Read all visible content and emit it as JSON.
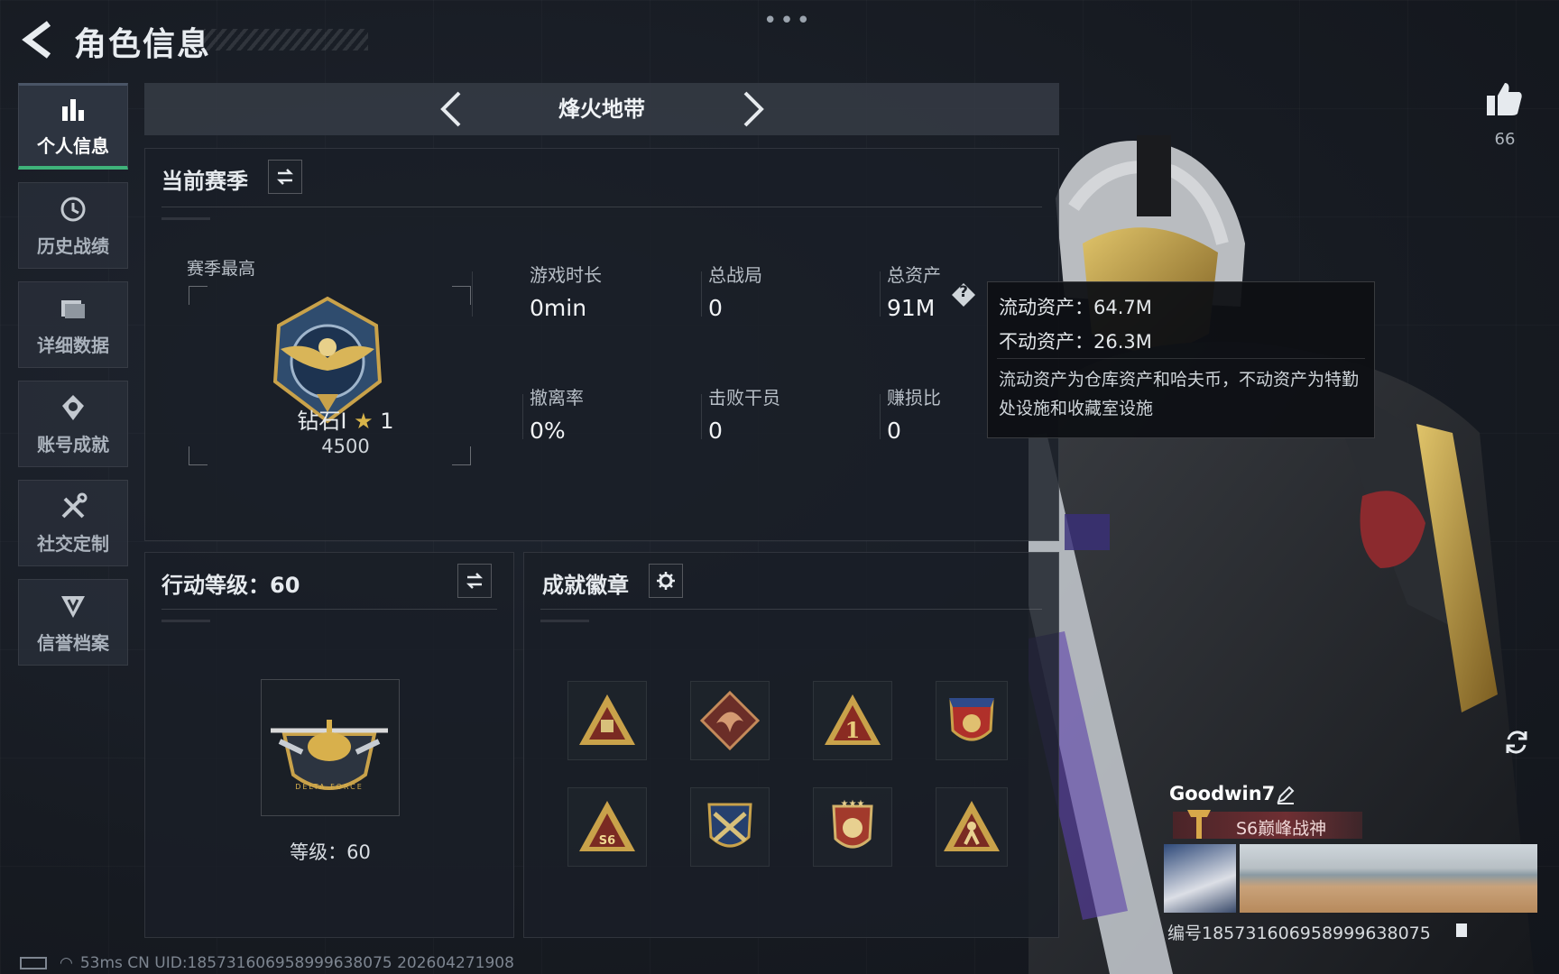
{
  "header": {
    "title": "角色信息",
    "more": "•••"
  },
  "sidebar": {
    "items": [
      {
        "label": "个人信息",
        "icon": "bar-chart-icon",
        "active": true
      },
      {
        "label": "历史战绩",
        "icon": "history-clock-icon"
      },
      {
        "label": "详细数据",
        "icon": "folder-icon"
      },
      {
        "label": "账号成就",
        "icon": "achievement-icon"
      },
      {
        "label": "社交定制",
        "icon": "tools-icon"
      },
      {
        "label": "信誉档案",
        "icon": "credit-icon"
      }
    ]
  },
  "mode": {
    "title": "烽火地带"
  },
  "season": {
    "heading": "当前赛季",
    "best_label": "赛季最高",
    "rank_name": "钻石I",
    "rank_stars": "1",
    "rank_points": "4500",
    "stats": [
      {
        "label": "游戏时长",
        "value": "0min"
      },
      {
        "label": "总战局",
        "value": "0"
      },
      {
        "label": "总资产",
        "value": "91M"
      },
      {
        "label": "撤离率",
        "value": "0%"
      },
      {
        "label": "击败干员",
        "value": "0"
      },
      {
        "label": "赚损比",
        "value": "0"
      }
    ],
    "help_glyph": "?"
  },
  "tooltip": {
    "liquid": "流动资产：64.7M",
    "fixed": "不动资产：26.3M",
    "description": "流动资产为仓库资产和哈夫币，不动资产为特勤处设施和收藏室设施"
  },
  "action_level": {
    "heading": "行动等级：60",
    "level_text": "等级：60",
    "emblem_text": "DELTA FORCE"
  },
  "achievements": {
    "heading": "成就徽章",
    "badges": [
      "triangle-gold-badge",
      "dragon-badge",
      "number-one-badge",
      "shield-star-badge",
      "s6-triangle-badge",
      "crossed-guns-badge",
      "star-shield-badge",
      "climber-badge"
    ],
    "s6_text": "S6",
    "one_text": "1"
  },
  "likes": {
    "count": "66"
  },
  "player": {
    "name": "Goodwin7",
    "title": "S6巅峰战神",
    "uid_line": "编号1857316069589996380​75"
  },
  "footer": {
    "text": "53ms    CN UID:1857316069589996380​75 202604271908"
  },
  "colors": {
    "accent_green": "#3fb37a",
    "tooltip_bg": "#0e1014",
    "gold": "#c9a24a"
  }
}
